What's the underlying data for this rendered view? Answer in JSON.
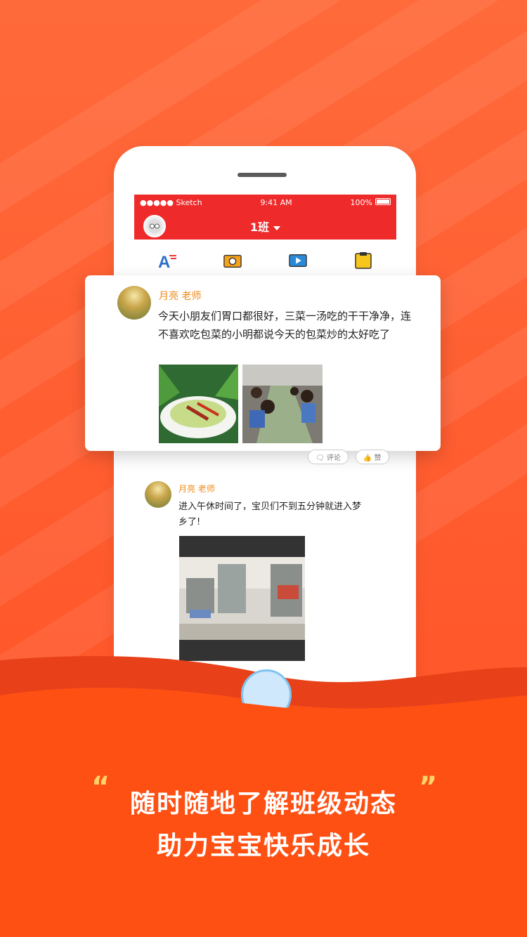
{
  "status_bar": {
    "carrier": "●●●●● Sketch",
    "time": "9:41 AM",
    "battery": "100%"
  },
  "navbar": {
    "class_name": "1班"
  },
  "post_overlay": {
    "author": "月亮 老师",
    "text": "今天小朋友们胃口都很好，三菜一汤吃的干干净净，连不喜欢吃包菜的小明都说今天的包菜炒的太好吃了"
  },
  "post_actions": {
    "comment": "评论",
    "like": "赞"
  },
  "post2": {
    "author": "月亮 老师",
    "text": "进入午休时间了，宝贝们不到五分钟就进入梦乡了!"
  },
  "slogan": {
    "line1": "随时随地了解班级动态",
    "line2": "助力宝宝快乐成长",
    "open_quote": "“",
    "close_quote": "”"
  },
  "colors": {
    "brand_red": "#ef2a2a",
    "background_orange": "#ff5a2e",
    "author_orange": "#f08a1a",
    "quote_yellow": "#ffd36a"
  },
  "icons": [
    "font-icon",
    "camera-icon",
    "video-icon",
    "notice-icon"
  ]
}
